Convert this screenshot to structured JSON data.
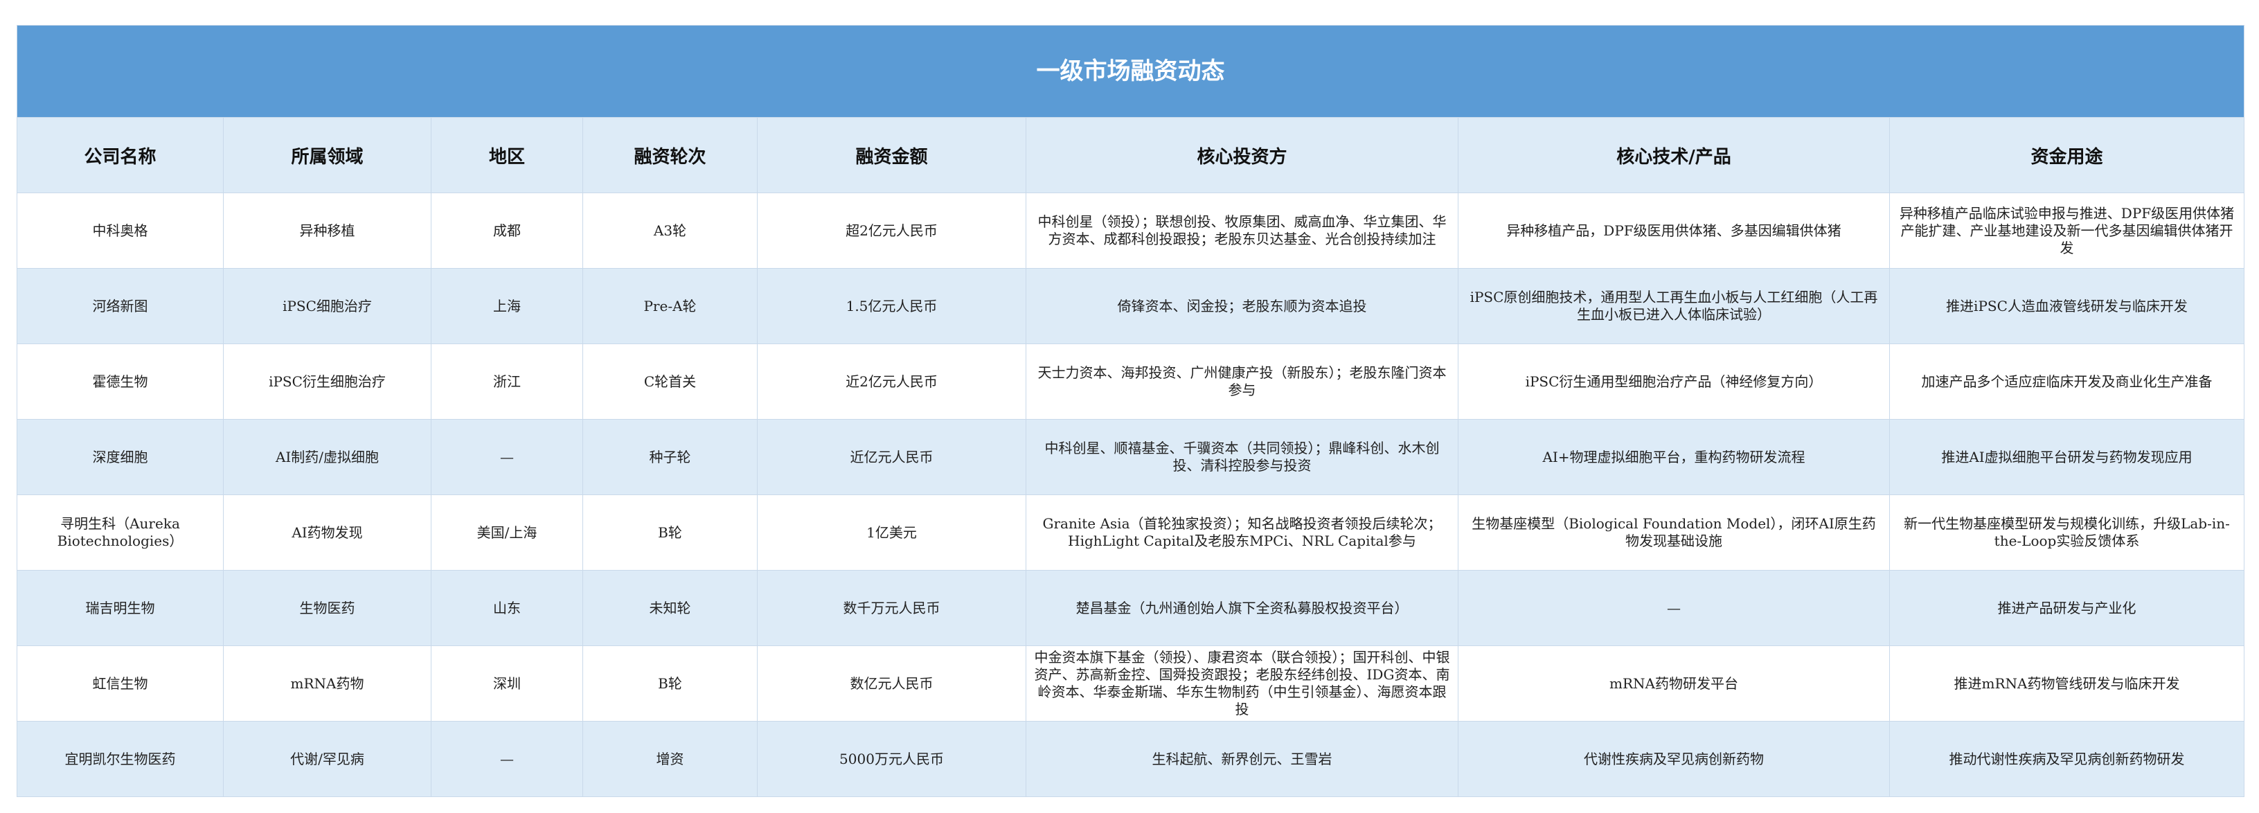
{
  "title": "一级市场融资动态",
  "headers": [
    "公司名称",
    "所属领域",
    "地区",
    "融资轮次",
    "融资金额",
    "核心投资方",
    "核心技术/产品",
    "资金用途"
  ],
  "rows": [
    {
      "company": "中科奥格",
      "field": "异种移植",
      "region": "成都",
      "round": "A3轮",
      "amount": "超2亿元人民币",
      "investors": "中科创星（领投）；联想创投、牧原集团、威高血净、华立集团、华方资本、成都科创投跟投；老股东贝达基金、光合创投持续加注",
      "tech": "异种移植产品，DPF级医用供体猪、多基因编辑供体猪",
      "use": "异种移植产品临床试验申报与推进、DPF级医用供体猪产能扩建、产业基地建设及新一代多基因编辑供体猪开发"
    },
    {
      "company": "河络新图",
      "field": "iPSC细胞治疗",
      "region": "上海",
      "round": "Pre-A轮",
      "amount": "1.5亿元人民币",
      "investors": "倚锋资本、闵金投；老股东顺为资本追投",
      "tech": "iPSC原创细胞技术，通用型人工再生血小板与人工红细胞（人工再生血小板已进入人体临床试验）",
      "use": "推进iPSC人造血液管线研发与临床开发"
    },
    {
      "company": "霍德生物",
      "field": "iPSC衍生细胞治疗",
      "region": "浙江",
      "round": "C轮首关",
      "amount": "近2亿元人民币",
      "investors": "天士力资本、海邦投资、广州健康产投（新股东）；老股东隆门资本参与",
      "tech": "iPSC衍生通用型细胞治疗产品（神经修复方向）",
      "use": "加速产品多个适应症临床开发及商业化生产准备"
    },
    {
      "company": "深度细胞",
      "field": "AI制药/虚拟细胞",
      "region": "—",
      "round": "种子轮",
      "amount": "近亿元人民币",
      "investors": "中科创星、顺禧基金、千骥资本（共同领投）；鼎峰科创、水木创投、清科控股参与投资",
      "tech": "AI+物理虚拟细胞平台，重构药物研发流程",
      "use": "推进AI虚拟细胞平台研发与药物发现应用"
    },
    {
      "company": "寻明生科（Aureka Biotechnologies）",
      "field": "AI药物发现",
      "region": "美国/上海",
      "round": "B轮",
      "amount": "1亿美元",
      "investors": "Granite Asia（首轮独家投资）；知名战略投资者领投后续轮次；HighLight Capital及老股东MPCi、NRL Capital参与",
      "tech": "生物基座模型（Biological Foundation Model），闭环AI原生药物发现基础设施",
      "use": "新一代生物基座模型研发与规模化训练，升级Lab-in-the-Loop实验反馈体系"
    },
    {
      "company": "瑞吉明生物",
      "field": "生物医药",
      "region": "山东",
      "round": "未知轮",
      "amount": "数千万元人民币",
      "investors": "楚昌基金（九州通创始人旗下全资私募股权投资平台）",
      "tech": "—",
      "use": "推进产品研发与产业化"
    },
    {
      "company": "虹信生物",
      "field": "mRNA药物",
      "region": "深圳",
      "round": "B轮",
      "amount": "数亿元人民币",
      "investors": "中金资本旗下基金（领投）、康君资本（联合领投）；国开科创、中银资产、苏高新金控、国舜投资跟投；老股东经纬创投、IDG资本、南岭资本、华泰金斯瑞、华东生物制药（中生引领基金）、海愿资本跟投",
      "tech": "mRNA药物研发平台",
      "use": "推进mRNA药物管线研发与临床开发"
    },
    {
      "company": "宜明凯尔生物医药",
      "field": "代谢/罕见病",
      "region": "—",
      "round": "增资",
      "amount": "5000万元人民币",
      "investors": "生科起航、新界创元、王雪岩",
      "tech": "代谢性疾病及罕见病创新药物",
      "use": "推动代谢性疾病及罕见病创新药物研发"
    }
  ]
}
